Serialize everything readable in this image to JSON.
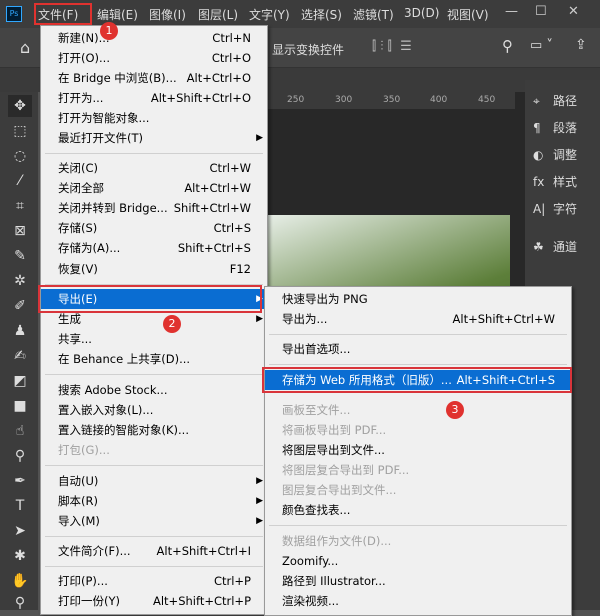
{
  "app": {
    "logo": "Ps"
  },
  "menubar": [
    "文件(F)",
    "编辑(E)",
    "图像(I)",
    "图层(L)",
    "文字(Y)",
    "选择(S)",
    "滤镜(T)",
    "3D(D)",
    "视图(V)"
  ],
  "window_controls": {
    "minimize": "—",
    "maximize": "☐",
    "close": "✕"
  },
  "optbar": {
    "transform_label": "显示变换控件"
  },
  "ruler": [
    "250",
    "300",
    "350",
    "400",
    "450"
  ],
  "right_panel": [
    {
      "icon": "path-icon",
      "label": "路径"
    },
    {
      "icon": "paragraph-icon",
      "label": "段落"
    },
    {
      "icon": "adjust-icon",
      "label": "调整"
    },
    {
      "icon": "fx-icon",
      "label": "样式"
    },
    {
      "icon": "character-icon",
      "label": "字符"
    },
    {
      "icon": "channels-icon",
      "label": "通道"
    }
  ],
  "file_menu": [
    {
      "label": "新建(N)...",
      "shortcut": "Ctrl+N"
    },
    {
      "label": "打开(O)...",
      "shortcut": "Ctrl+O"
    },
    {
      "label": "在 Bridge 中浏览(B)...",
      "shortcut": "Alt+Ctrl+O"
    },
    {
      "label": "打开为...",
      "shortcut": "Alt+Shift+Ctrl+O"
    },
    {
      "label": "打开为智能对象...",
      "shortcut": ""
    },
    {
      "label": "最近打开文件(T)",
      "shortcut": "",
      "submenu": true
    },
    {
      "label": "关闭(C)",
      "shortcut": "Ctrl+W"
    },
    {
      "label": "关闭全部",
      "shortcut": "Alt+Ctrl+W"
    },
    {
      "label": "关闭并转到 Bridge...",
      "shortcut": "Shift+Ctrl+W"
    },
    {
      "label": "存储(S)",
      "shortcut": "Ctrl+S"
    },
    {
      "label": "存储为(A)...",
      "shortcut": "Shift+Ctrl+S"
    },
    {
      "label": "恢复(V)",
      "shortcut": "F12"
    },
    {
      "label": "导出(E)",
      "shortcut": "",
      "submenu": true,
      "highlighted": true
    },
    {
      "label": "生成",
      "shortcut": "",
      "submenu": true
    },
    {
      "label": "共享...",
      "shortcut": ""
    },
    {
      "label": "在 Behance 上共享(D)...",
      "shortcut": ""
    },
    {
      "label": "搜索 Adobe Stock...",
      "shortcut": ""
    },
    {
      "label": "置入嵌入对象(L)...",
      "shortcut": ""
    },
    {
      "label": "置入链接的智能对象(K)...",
      "shortcut": ""
    },
    {
      "label": "打包(G)...",
      "shortcut": "",
      "disabled": true
    },
    {
      "label": "自动(U)",
      "shortcut": "",
      "submenu": true
    },
    {
      "label": "脚本(R)",
      "shortcut": "",
      "submenu": true
    },
    {
      "label": "导入(M)",
      "shortcut": "",
      "submenu": true
    },
    {
      "label": "文件简介(F)...",
      "shortcut": "Alt+Shift+Ctrl+I"
    },
    {
      "label": "打印(P)...",
      "shortcut": "Ctrl+P"
    },
    {
      "label": "打印一份(Y)",
      "shortcut": "Alt+Shift+Ctrl+P"
    }
  ],
  "export_menu": [
    {
      "label": "快速导出为 PNG",
      "shortcut": ""
    },
    {
      "label": "导出为...",
      "shortcut": "Alt+Shift+Ctrl+W"
    },
    {
      "label": "导出首选项...",
      "shortcut": ""
    },
    {
      "label": "存储为 Web 所用格式（旧版）...",
      "shortcut": "Alt+Shift+Ctrl+S",
      "highlighted": true
    },
    {
      "label": "画板至文件...",
      "shortcut": "",
      "disabled": true
    },
    {
      "label": "将画板导出到 PDF...",
      "shortcut": "",
      "disabled": true
    },
    {
      "label": "将图层导出到文件...",
      "shortcut": ""
    },
    {
      "label": "将图层复合导出到 PDF...",
      "shortcut": "",
      "disabled": true
    },
    {
      "label": "图层复合导出到文件...",
      "shortcut": "",
      "disabled": true
    },
    {
      "label": "颜色查找表...",
      "shortcut": ""
    },
    {
      "label": "数据组作为文件(D)...",
      "shortcut": "",
      "disabled": true
    },
    {
      "label": "Zoomify...",
      "shortcut": ""
    },
    {
      "label": "路径到 Illustrator...",
      "shortcut": ""
    },
    {
      "label": "渲染视频...",
      "shortcut": ""
    }
  ],
  "badges": [
    "1",
    "2",
    "3"
  ],
  "colors": {
    "highlight": "#0a6dd2",
    "annotation": "#e0322f"
  }
}
